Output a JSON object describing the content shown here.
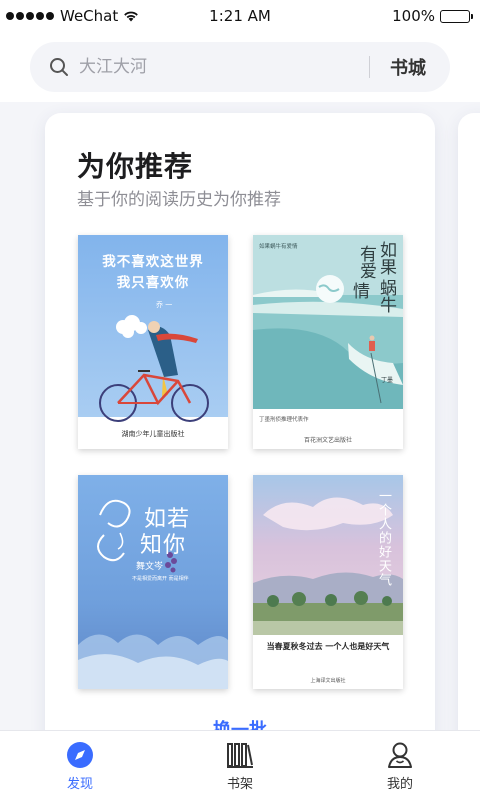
{
  "status_bar": {
    "carrier": "WeChat",
    "time": "1:21 AM",
    "battery": "100%"
  },
  "search": {
    "placeholder": "大江大河",
    "store_label": "书城"
  },
  "recommend": {
    "title": "为你推荐",
    "subtitle": "基于你的阅读历史为你推荐",
    "refresh_label": "换一批",
    "books": [
      {
        "title_line1": "我不喜欢这世界",
        "title_line2": "我只喜欢你",
        "author": "乔 一",
        "publisher": "湖南少年儿童出版社"
      },
      {
        "title_col1": "如果",
        "title_col2": "有爱",
        "title_col3": "蜗牛",
        "title_col4": "情",
        "intro": "如果蜗牛有爱情",
        "author": "丁墨",
        "blurb": "丁墨刑侦推理代表作",
        "publisher": "百花洲文艺出版社"
      },
      {
        "title_a": "如若",
        "title_b": "知你",
        "author": "舞文岑",
        "tagline": "不是相爱而离开 而是相伴"
      },
      {
        "title_vertical": "一个人的好天气",
        "headline": "当春夏秋冬过去 一个人也是好天气",
        "publisher": "上海译文出版社"
      }
    ]
  },
  "tabs": [
    {
      "label": "发现",
      "icon": "compass-icon",
      "active": true
    },
    {
      "label": "书架",
      "icon": "bookshelf-icon",
      "active": false
    },
    {
      "label": "我的",
      "icon": "person-icon",
      "active": false
    }
  ],
  "colors": {
    "accent": "#3a6cff",
    "background": "#f4f5f9"
  }
}
